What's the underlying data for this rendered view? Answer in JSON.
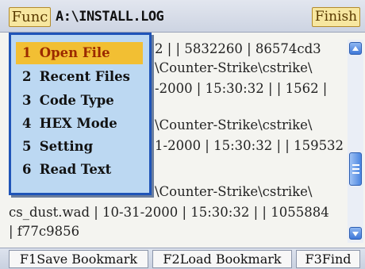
{
  "topbar": {
    "func_label": "Func",
    "title": "A:\\INSTALL.LOG",
    "finish_label": "Finish"
  },
  "text_lines": [
    "2 | | 5832260 | 86574cd3",
    "\\Counter-Strike\\cstrike\\",
    "-2000 | 15:30:32 | | 1562 |",
    "\\Counter-Strike\\cstrike\\",
    "1-2000 | 15:30:32 | | 159532",
    "\\Counter-Strike\\cstrike\\",
    "cs_dust.wad | 10-31-2000 | 15:30:32 | | 1055884",
    "| f77c9856"
  ],
  "menu": {
    "items": [
      {
        "num": "1",
        "label": "Open File",
        "selected": true
      },
      {
        "num": "2",
        "label": "Recent Files",
        "selected": false
      },
      {
        "num": "3",
        "label": "Code Type",
        "selected": false
      },
      {
        "num": "4",
        "label": "HEX Mode",
        "selected": false
      },
      {
        "num": "5",
        "label": "Setting",
        "selected": false
      },
      {
        "num": "6",
        "label": "Read Text",
        "selected": false
      }
    ]
  },
  "bottombar": {
    "f1_label": "F1Save Bookmark",
    "f2_label": "F2Load Bookmark",
    "f3_label": "F3Find"
  },
  "colors": {
    "menu_background": "#bcd8f2",
    "menu_border": "#1f54b8",
    "menu_selected": "#f2bf33",
    "button_gold": "#f7e7a0"
  },
  "icons": [
    "scroll-up-arrow-icon",
    "scroll-down-arrow-icon",
    "scroll-thumb-grip-icon"
  ]
}
